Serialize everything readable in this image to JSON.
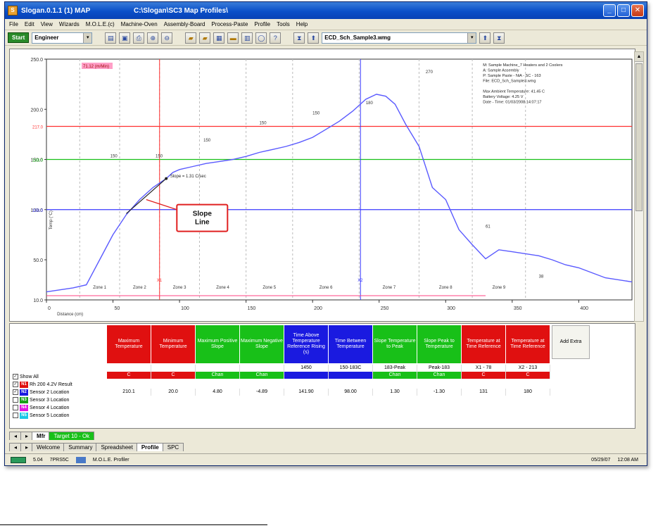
{
  "window": {
    "title": "Slogan.0.1.1 (1) MAP",
    "subtitle": "C:\\Slogan\\SC3 Map Profiles\\",
    "minimize": "_",
    "maximize": "□",
    "close": "✕"
  },
  "menu": [
    "File",
    "Edit",
    "View",
    "Wizards",
    "M.O.L.E.(c)",
    "Machine-Oven",
    "Assembly-Board",
    "Process-Paste",
    "Profile",
    "Tools",
    "Help"
  ],
  "toolbar": {
    "start_label": "Start",
    "user_combo": "Engineer",
    "file_combo": "ECD_Sch_Sample3.wmg",
    "dropdown_glyph": "▾"
  },
  "chart": {
    "y_ticks": [
      "250.0",
      "200.0",
      "150.0",
      "100.0",
      "50.0",
      "10.0"
    ],
    "x_ticks": [
      "0",
      "50",
      "100",
      "150",
      "200",
      "250",
      "300",
      "350",
      "400"
    ],
    "ref_labels": [
      "217.0",
      "183.0",
      "150.0"
    ],
    "y_axis_label": "Temp (°C)",
    "x_axis_label": "Distance (cm)",
    "corner_label": "71.12 (m/Min)",
    "cursor_labels": [
      "X1",
      "X2"
    ],
    "zones": [
      "Zone 1",
      "Zone 2",
      "Zone 3",
      "Zone 4",
      "Zone 5",
      "Zone 6",
      "Zone 7",
      "Zone 8",
      "Zone 9"
    ],
    "dimension_labels": [
      "150",
      "150",
      "150",
      "150",
      "150",
      "180",
      "270",
      "61",
      "38"
    ],
    "slope_readout": "Slope = 1.31 C/sec",
    "callout": "Slope Line",
    "info_lines": [
      "M: Sample Machine_7 Heaters and 2 Coolers",
      "A: Sample Assembly",
      "P: Sample Paste - NiA - SC - 163",
      "File: ECD_Sch_Sample3.wmg",
      "",
      "Max Ambient Temperature: 41.45 C",
      "Battery Voltage: 4.25 V",
      "Date - Time: 01/03/2008 14:07:17"
    ],
    "colors": {
      "profile": "#5a5aff",
      "red_line": "#ff3030",
      "green_line": "#18c018",
      "blue_line": "#3a3aff",
      "cursor": "#ff3030"
    }
  },
  "chart_data": {
    "type": "line",
    "title": "",
    "xlabel": "Distance (cm)",
    "ylabel": "Temp (°C)",
    "xlim": [
      0,
      440
    ],
    "ylim": [
      10,
      250
    ],
    "grid": false,
    "series": [
      {
        "x": [
          0,
          20,
          30,
          40,
          50,
          60,
          70,
          80,
          90,
          95,
          100,
          110,
          120,
          130,
          140,
          150,
          160,
          170,
          180,
          190,
          200,
          210,
          220,
          230,
          240,
          248,
          255,
          262,
          270,
          280,
          290,
          300,
          310,
          320,
          330,
          340,
          350,
          360,
          370,
          380,
          390,
          400,
          420,
          440
        ],
        "y": [
          18,
          22,
          25,
          50,
          75,
          95,
          110,
          122,
          131,
          137,
          140,
          143,
          146,
          148,
          150,
          153,
          157,
          160,
          163,
          167,
          172,
          180,
          188,
          198,
          210,
          215,
          213,
          205,
          185,
          163,
          122,
          110,
          80,
          65,
          51,
          60,
          58,
          56,
          54,
          50,
          45,
          42,
          32,
          28
        ]
      }
    ],
    "reference_lines": [
      {
        "axis": "y",
        "value": 183.0,
        "color": "#ff3030"
      },
      {
        "axis": "y",
        "value": 150.0,
        "color": "#18c018"
      },
      {
        "axis": "y",
        "value": 100.0,
        "color": "#3a3aff"
      }
    ],
    "cursors": [
      {
        "axis": "x",
        "value": 85,
        "color": "#ff3030"
      },
      {
        "axis": "x",
        "value": 236,
        "color": "#3a3aff"
      }
    ]
  },
  "grid": {
    "show_all": "Show All",
    "add_extra": "Add Extra",
    "columns": [
      {
        "label": "Maximum Temperature",
        "color": "#e01010",
        "spec": "",
        "status": "C",
        "value": "210.1"
      },
      {
        "label": "Minimum Temperature",
        "color": "#e01010",
        "spec": "",
        "status": "C",
        "value": "20.0"
      },
      {
        "label": "Maximum Positive Slope",
        "color": "#18c018",
        "spec": "",
        "status": "Chan",
        "value": "4.80"
      },
      {
        "label": "Maximum Negative Slope",
        "color": "#18c018",
        "spec": "",
        "status": "Chan",
        "value": "-4.89"
      },
      {
        "label": "Time Above Temperature Reference Rising (s)",
        "color": "#1a1ae0",
        "spec": "1450",
        "status": "",
        "value": "141.90"
      },
      {
        "label": "Time Between Temperature",
        "color": "#1a1ae0",
        "spec": "150-183C",
        "status": "",
        "value": "98.00"
      },
      {
        "label": "Slope Temperature to Peak",
        "color": "#18c018",
        "spec": "183-Peak",
        "status": "Chan",
        "value": "1.30"
      },
      {
        "label": "Slope Peak to Temperature",
        "color": "#18c018",
        "spec": "Peak-183",
        "status": "Chan",
        "value": "-1.30"
      },
      {
        "label": "Temperature at Time Reference",
        "color": "#e01010",
        "spec": "X1 - 78",
        "status": "C",
        "value": "131"
      },
      {
        "label": "Temperature at Time Reference",
        "color": "#e01010",
        "spec": "X2 - 213",
        "status": "C",
        "value": "180"
      }
    ],
    "rows": [
      {
        "id": "N1",
        "label": "Rh 200 4.2V Result",
        "color": "#e01010",
        "checked": "✓"
      },
      {
        "id": "N2",
        "label": "Sensor 2 Location",
        "color": "#1a1ae0",
        "checked": "✓"
      },
      {
        "id": "N3",
        "label": "Sensor 3 Location",
        "color": "#18a018",
        "checked": ""
      },
      {
        "id": "N4",
        "label": "Sensor 4 Location",
        "color": "#e018e0",
        "checked": ""
      },
      {
        "id": "N5",
        "label": "Sensor 5 Location",
        "color": "#18c8e8",
        "checked": ""
      }
    ],
    "sheet_tabs": [
      "Mfr",
      "Target 10 - Ok"
    ]
  },
  "bottom_tabs": [
    "Welcome",
    "Summary",
    "Spreadsheet",
    "Profile",
    "SPC"
  ],
  "status": {
    "version": "5.04",
    "battery": "7PRS5C",
    "mode": "M.O.L.E. Profiler",
    "date": "05/29/07",
    "time": "12:08 AM"
  }
}
